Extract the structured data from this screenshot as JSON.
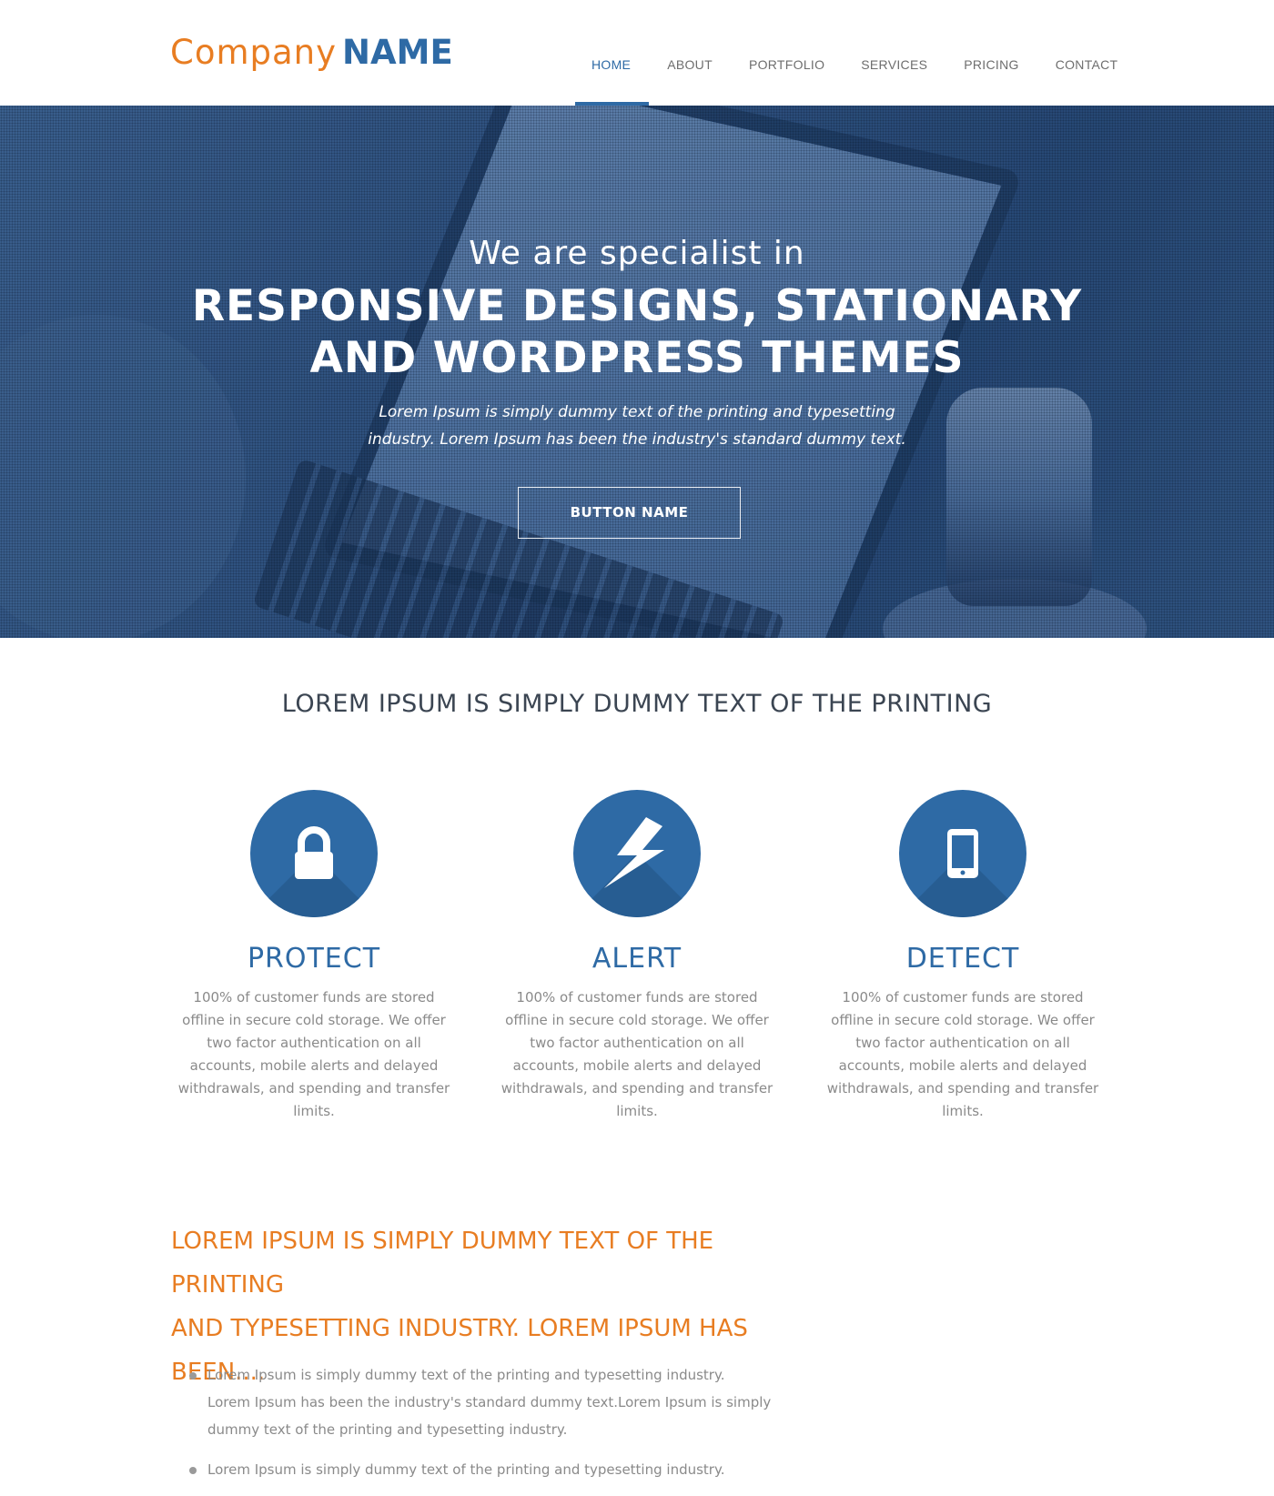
{
  "header": {
    "logo_light": "Company",
    "logo_bold": "NAME",
    "nav": [
      {
        "label": "HOME",
        "active": true
      },
      {
        "label": "ABOUT",
        "active": false
      },
      {
        "label": "PORTFOLIO",
        "active": false
      },
      {
        "label": "SERVICES",
        "active": false
      },
      {
        "label": "PRICING",
        "active": false
      },
      {
        "label": "CONTACT",
        "active": false
      }
    ]
  },
  "hero": {
    "intro": "We are specialist in",
    "title_line1": "RESPONSIVE DESIGNS, STATIONARY",
    "title_line2": "AND WORDPRESS THEMES",
    "desc_line1": "Lorem Ipsum is simply dummy text of the printing and typesetting",
    "desc_line2": "industry. Lorem Ipsum has been the industry's standard dummy text.",
    "button": "BUTTON NAME"
  },
  "features": {
    "title": "LOREM IPSUM IS SIMPLY DUMMY TEXT OF THE PRINTING",
    "items": [
      {
        "icon": "lock-icon",
        "title": "PROTECT",
        "desc": "100% of customer funds are stored offline in secure cold storage. We offer two factor authentication on all accounts, mobile alerts and delayed withdrawals, and spending and transfer limits."
      },
      {
        "icon": "lightning-icon",
        "title": "ALERT",
        "desc": "100% of customer funds are stored offline in secure cold storage. We offer two factor authentication on all accounts, mobile alerts and delayed withdrawals, and spending and transfer limits."
      },
      {
        "icon": "mobile-phone-icon",
        "title": "DETECT",
        "desc": "100% of customer funds are stored offline in secure cold storage. We offer two factor authentication on all accounts, mobile alerts and delayed withdrawals, and spending and transfer limits."
      }
    ]
  },
  "lower": {
    "heading_line1": "LOREM IPSUM IS SIMPLY DUMMY TEXT OF THE PRINTING",
    "heading_line2": "AND TYPESETTING INDUSTRY. LOREM IPSUM HAS BEEN....",
    "bullets": [
      "Lorem Ipsum is simply dummy text of the printing and typesetting industry. Lorem Ipsum has been the industry's standard dummy text.Lorem Ipsum is simply dummy text of the printing and typesetting industry.",
      "Lorem Ipsum is simply dummy text of the printing and typesetting industry."
    ]
  },
  "colors": {
    "brand_blue": "#2e6aa5",
    "brand_orange": "#e87d22",
    "text_gray": "#8a8a8a"
  }
}
